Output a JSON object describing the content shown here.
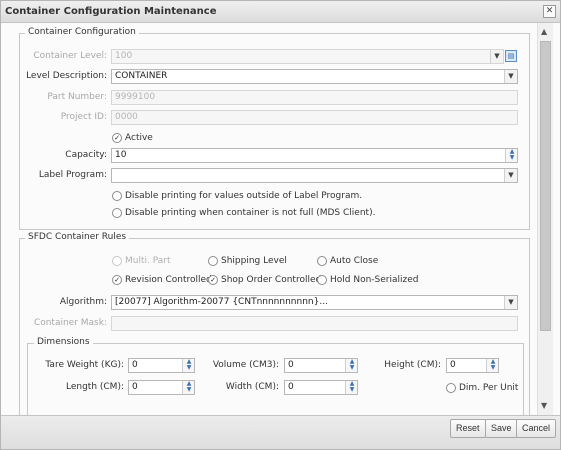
{
  "window": {
    "title": "Container Configuration Maintenance",
    "close_label": "✕"
  },
  "container_config": {
    "legend": "Container Configuration",
    "container_level": {
      "label": "Container Level:",
      "value": "100"
    },
    "level_description": {
      "label": "Level Description:",
      "value": "CONTAINER"
    },
    "part_number": {
      "label": "Part Number:",
      "value": "9999100"
    },
    "project_id": {
      "label": "Project ID:",
      "value": "0000"
    },
    "active": {
      "label": "Active",
      "checked": true
    },
    "capacity": {
      "label": "Capacity:",
      "value": "10"
    },
    "label_program": {
      "label": "Label Program:",
      "value": ""
    },
    "disable_outside": {
      "label": "Disable printing for values outside of Label Program.",
      "checked": false
    },
    "disable_not_full": {
      "label": "Disable printing when container is not full (MDS Client).",
      "checked": false
    }
  },
  "sfdc_rules": {
    "legend": "SFDC Container Rules",
    "options": [
      {
        "label": "Multi. Part",
        "checked": false,
        "disabled": true
      },
      {
        "label": "Shipping Level",
        "checked": false,
        "disabled": false
      },
      {
        "label": "Auto Close",
        "checked": false,
        "disabled": false
      },
      {
        "label": "Revision Controlled",
        "checked": true,
        "disabled": false
      },
      {
        "label": "Shop Order Controlled",
        "checked": true,
        "disabled": false
      },
      {
        "label": "Hold Non-Serialized",
        "checked": false,
        "disabled": false
      }
    ],
    "algorithm": {
      "label": "Algorithm:",
      "value": "[20077] Algorithm-20077 {CNTnnnnnnnnnn}..."
    },
    "container_mask": {
      "label": "Container Mask:",
      "value": ""
    }
  },
  "dimensions": {
    "legend": "Dimensions",
    "tare_weight": {
      "label": "Tare Weight (KG):",
      "value": "0"
    },
    "volume": {
      "label": "Volume (CM3):",
      "value": "0"
    },
    "height": {
      "label": "Height (CM):",
      "value": "0"
    },
    "length": {
      "label": "Length (CM):",
      "value": "0"
    },
    "width": {
      "label": "Width (CM):",
      "value": "0"
    },
    "dim_per_unit": {
      "label": "Dim. Per Unit",
      "checked": false
    }
  },
  "buttons": {
    "reset": "Reset",
    "save": "Save",
    "cancel": "Cancel"
  },
  "icons": {
    "dropdown": "chevron-down-icon",
    "spinner": "spinner-arrows-icon",
    "lookup": "lookup-icon",
    "close": "close-icon"
  }
}
